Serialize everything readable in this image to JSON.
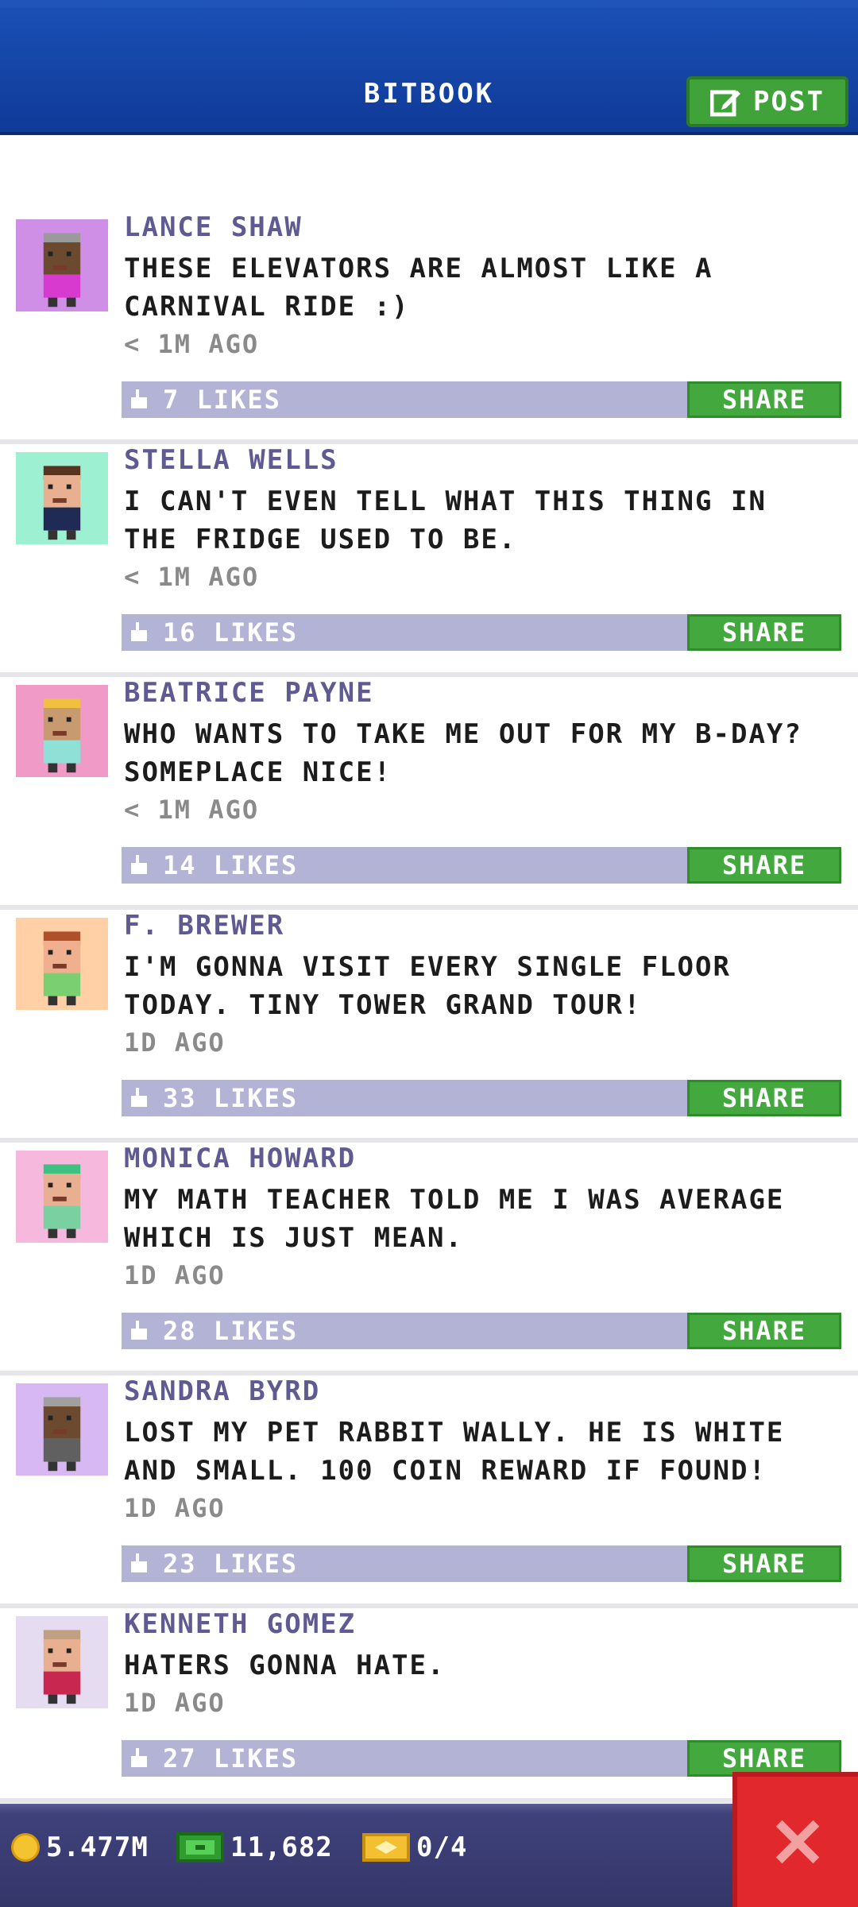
{
  "header": {
    "title": "BITBOOK",
    "post_label": "POST"
  },
  "posts": [
    {
      "name": "LANCE SHAW",
      "message": "THESE ELEVATORS ARE ALMOST LIKE A CARNIVAL RIDE :)",
      "time": "< 1M AGO",
      "likes": "7 LIKES",
      "share": "SHARE",
      "avatar_bg": "#cf8fe6",
      "skin": "#6b4a2f",
      "hair": "#9a9a9a",
      "shirt": "#d83ad0"
    },
    {
      "name": "STELLA WELLS",
      "message": "I CAN'T EVEN TELL WHAT THIS THING IN THE FRIDGE USED TO BE.",
      "time": "< 1M AGO",
      "likes": "16 LIKES",
      "share": "SHARE",
      "avatar_bg": "#9ef0d2",
      "skin": "#e8b090",
      "hair": "#5a3320",
      "shirt": "#1f2a55"
    },
    {
      "name": "BEATRICE PAYNE",
      "message": "WHO WANTS TO TAKE ME OUT FOR MY B-DAY? SOMEPLACE NICE!",
      "time": "< 1M AGO",
      "likes": "14 LIKES",
      "share": "SHARE",
      "avatar_bg": "#f09ac8",
      "skin": "#c89a70",
      "hair": "#f0c040",
      "shirt": "#8fe0d6"
    },
    {
      "name": "F. BREWER",
      "message": "I'M GONNA VISIT EVERY SINGLE FLOOR TODAY. TINY TOWER GRAND TOUR!",
      "time": "1D AGO",
      "likes": "33 LIKES",
      "share": "SHARE",
      "avatar_bg": "#ffcfa6",
      "skin": "#f0b090",
      "hair": "#b0502a",
      "shirt": "#7ad070"
    },
    {
      "name": "MONICA HOWARD",
      "message": "MY MATH TEACHER TOLD ME I WAS AVERAGE WHICH IS JUST MEAN.",
      "time": "1D AGO",
      "likes": "28 LIKES",
      "share": "SHARE",
      "avatar_bg": "#f6b8dc",
      "skin": "#e8b090",
      "hair": "#40c080",
      "shirt": "#7ad0a0"
    },
    {
      "name": "SANDRA BYRD",
      "message": "LOST MY PET RABBIT WALLY. HE IS WHITE AND SMALL. 100 COIN REWARD IF FOUND!",
      "time": "1D AGO",
      "likes": "23 LIKES",
      "share": "SHARE",
      "avatar_bg": "#d8b8f2",
      "skin": "#6b4a2f",
      "hair": "#a0a0a0",
      "shirt": "#606060"
    },
    {
      "name": "KENNETH GOMEZ",
      "message": "HATERS GONNA HATE.",
      "time": "1D AGO",
      "likes": "27 LIKES",
      "share": "SHARE",
      "avatar_bg": "#e6dcf2",
      "skin": "#e8b090",
      "hair": "#c0a080",
      "shirt": "#c82850"
    }
  ],
  "footer": {
    "coins": "5.477M",
    "bux": "11,682",
    "tickets": "0/4"
  },
  "colors": {
    "header_blue": "#1a4fb4",
    "accent_green": "#43a83e",
    "likes_bar": "#b3b3d6",
    "name_purple": "#5f5a92",
    "close_red": "#e0282d"
  }
}
